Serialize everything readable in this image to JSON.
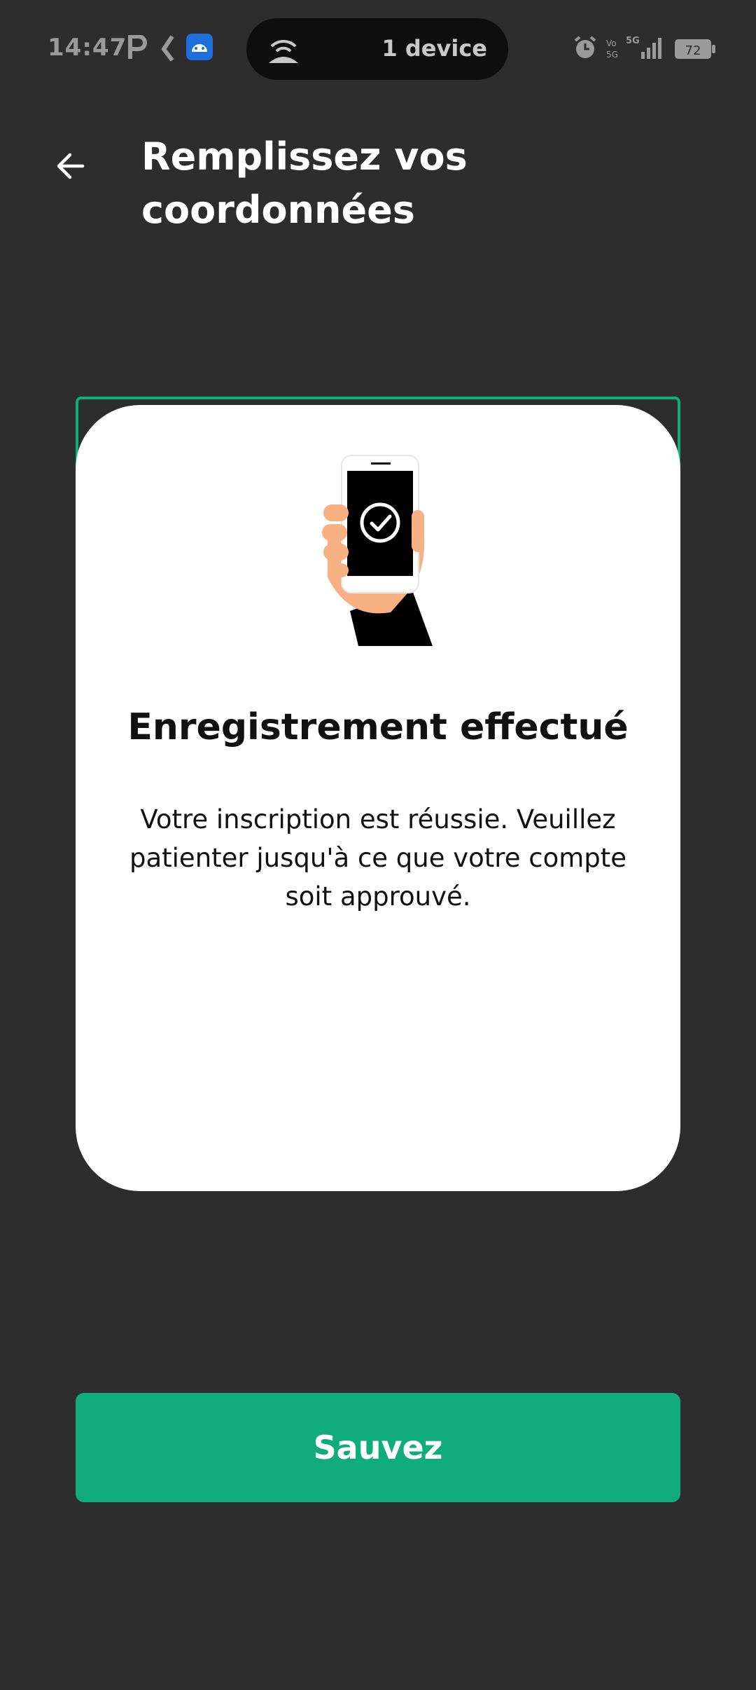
{
  "status_bar": {
    "time": "14:47",
    "battery": "72",
    "hotspot_label": "1 device",
    "network": "5G"
  },
  "header": {
    "title": "Remplissez vos coordonnées",
    "back_icon": "arrow-left-icon"
  },
  "card": {
    "title": "Enregistrement effectué",
    "message": "Votre inscription est réussie. Veuillez patienter jusqu'à ce que votre compte soit approuvé.",
    "illustration": "hand-holding-phone-check-icon"
  },
  "actions": {
    "save_label": "Sauvez"
  },
  "colors": {
    "background": "#2d2d2d",
    "accent": "#10ad7b",
    "card": "#ffffff"
  }
}
